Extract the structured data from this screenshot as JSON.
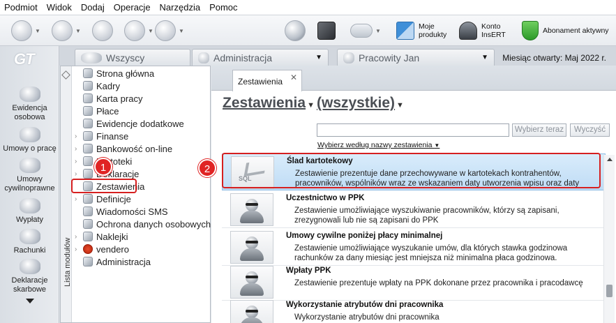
{
  "menu": [
    "Podmiot",
    "Widok",
    "Dodaj",
    "Operacje",
    "Narzędzia",
    "Pomoc"
  ],
  "toolbar": {
    "moje_produkty": [
      "Moje",
      "produkty"
    ],
    "konto_insert": [
      "Konto",
      "InsERT"
    ],
    "abonament": "Abonament aktywny"
  },
  "leftbar": {
    "logo": "GT",
    "items": [
      {
        "label1": "Ewidencja",
        "label2": "osobowa"
      },
      {
        "label1": "Umowy o pracę",
        "label2": ""
      },
      {
        "label1": "Umowy",
        "label2": "cywilnoprawne"
      },
      {
        "label1": "Wypłaty",
        "label2": ""
      },
      {
        "label1": "Rachunki",
        "label2": ""
      },
      {
        "label1": "Deklaracje",
        "label2": "skarbowe"
      }
    ]
  },
  "top_tabs": {
    "wszyscy": "Wszyscy",
    "administracja": "Administracja",
    "pracowity": "Pracowity Jan",
    "month": "Miesiąc otwarty:  Maj 2022 r."
  },
  "modules": {
    "side_label": "Lista modułów",
    "items": [
      "Strona główna",
      "Kadry",
      "Karta pracy",
      "Płace",
      "Ewidencje dodatkowe",
      "Finanse",
      "Bankowość on-line",
      "Kartoteki",
      "Deklaracje",
      "Zestawienia",
      "Definicje",
      "Wiadomości SMS",
      "Ochrona danych osobowych",
      "Naklejki",
      "vendero",
      "Administracja"
    ]
  },
  "content": {
    "tab": "Zestawienia",
    "heading": "Zestawienia",
    "filter": "(wszystkie)",
    "search_value": "",
    "btn_select": "Wybierz teraz",
    "btn_clear": "Wyczyść",
    "sort_link": "Wybierz według nazwy zestawienia",
    "rows": [
      {
        "title": "Ślad kartotekowy",
        "desc": "Zestawienie prezentuje dane przechowywane w kartotekach kontrahentów, pracowników, wspólników wraz ze wskazaniem daty utworzenia wpisu oraz daty"
      },
      {
        "title": "Uczestnictwo w PPK",
        "desc": "Zestawienie umożliwiające wyszukiwanie pracowników, którzy są zapisani, zrezygnowali lub nie są zapisani do PPK"
      },
      {
        "title": "Umowy cywilne poniżej płacy minimalnej",
        "desc": "Zestawienie umożliwiające wyszukanie umów, dla których stawka godzinowa rachunków za dany miesiąc jest mniejsza niż minimalna płaca godzinowa."
      },
      {
        "title": "Wpłaty PPK",
        "desc": "Zestawienie prezentuje wpłaty na PPK dokonane przez pracownika i pracodawcę"
      },
      {
        "title": "Wykorzystanie atrybutów dni pracownika",
        "desc": "Wykorzystanie atrybutów dni pracownika"
      }
    ]
  },
  "annotations": [
    "1",
    "2"
  ],
  "colors": {
    "highlight": "#d62020",
    "selection": "#bfdcf5"
  }
}
